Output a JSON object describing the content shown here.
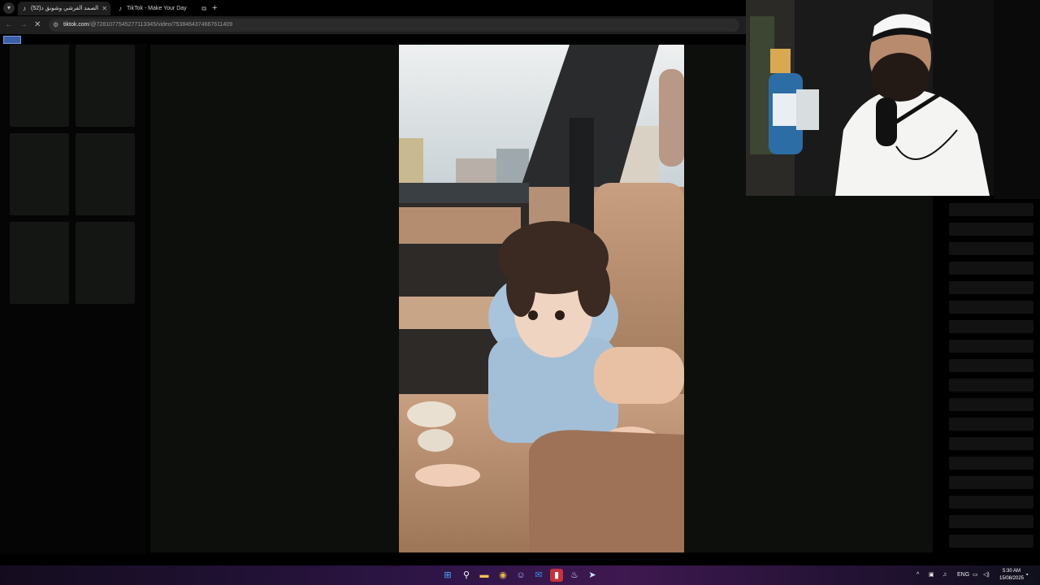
{
  "browser": {
    "tabs": [
      {
        "title": "(52)عبد الصمد القرشي وشونق د...",
        "active": true
      },
      {
        "title": "TikTok - Make Your Day",
        "active": false
      }
    ],
    "new_tab_label": "+",
    "address": {
      "host": "tiktok.com",
      "path": "/@7281077545277113345/video/7538464374667611409"
    }
  },
  "colors": {
    "stage_bg": "#0d0f0c",
    "taskbar_accent": "#3e1850",
    "toolbar_bg": "#1f1f1f"
  },
  "taskbar": {
    "tray_lang": "ENG",
    "time": "5:30 AM",
    "date": "15/08/2025"
  },
  "icons": {
    "taskbar": [
      "windows-start-icon",
      "search-icon",
      "file-explorer-icon",
      "chrome-icon",
      "discord-icon",
      "outlook-icon",
      "app-red-icon",
      "steam-icon",
      "steam-alt-icon"
    ]
  }
}
